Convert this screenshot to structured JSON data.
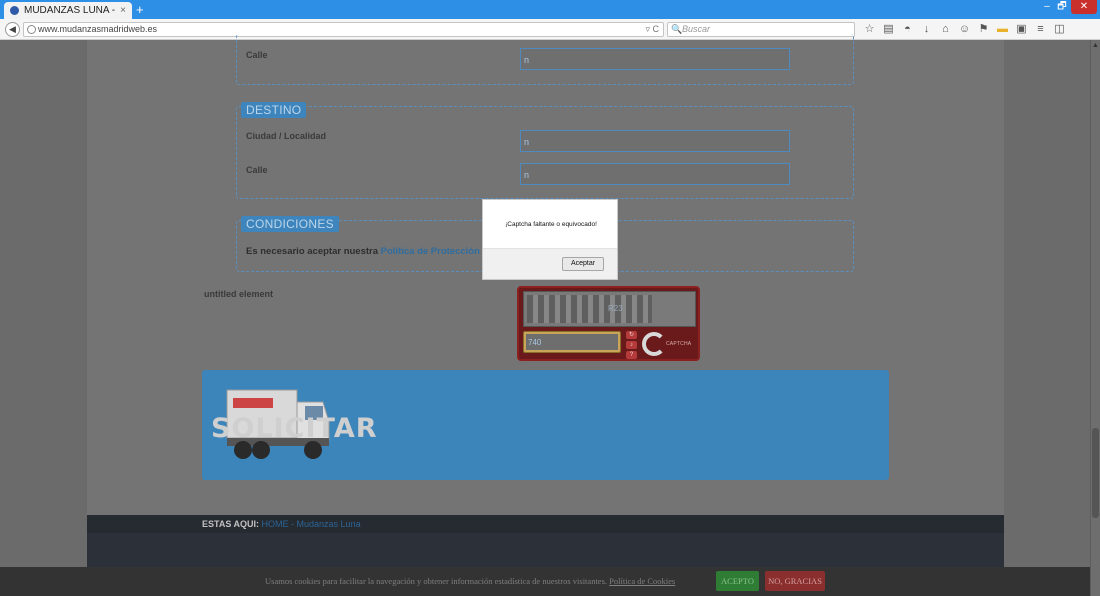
{
  "browser": {
    "tab_title": "MUDANZAS LUNA - EMPR...",
    "tab_close": "×",
    "new_tab": "+",
    "url": "www.mudanzasmadridweb.es",
    "search_placeholder": "Buscar",
    "window_controls": {
      "minimize": "–",
      "maximize": "🗗",
      "close": "✕"
    }
  },
  "form": {
    "origen_calle": {
      "label": "Calle",
      "value": "n"
    },
    "destino": {
      "legend": "DESTINO",
      "ciudad": {
        "label": "Ciudad / Localidad",
        "value": "n"
      },
      "calle": {
        "label": "Calle",
        "value": "n"
      }
    },
    "condiciones": {
      "legend": "CONDICIONES",
      "text": "Es necesario aceptar nuestra ",
      "link": "Política de Protección de Da"
    },
    "untitled_label": "untitled element",
    "captcha": {
      "code_shown": "R23",
      "input_value": "740",
      "logo_text": "CAPTCHA"
    },
    "banner_text": "SOLICITAR"
  },
  "footer": {
    "crumb_label": "ESTAS AQUI:",
    "crumb_home": "HOME",
    "crumb_sep": " - ",
    "crumb_current": "Mudanzas Luna"
  },
  "cookie_bar": {
    "message": "Usamos cookies para facilitar la navegación y obtener información estadística de nuestros visitantes. ",
    "policy_link": "Política de Cookies",
    "accept": "ACEPTO",
    "decline": "NO, GRACIAS"
  },
  "dialog": {
    "message": "¡Captcha faltante o equivocado!",
    "ok_label": "Aceptar"
  }
}
